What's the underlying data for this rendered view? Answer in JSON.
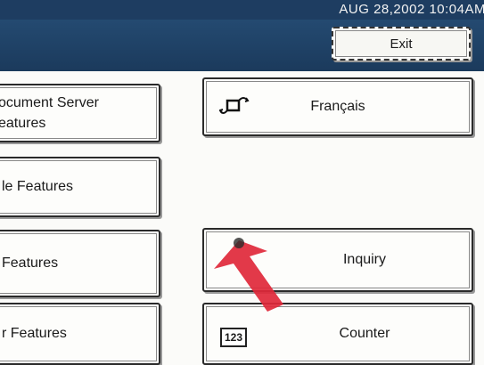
{
  "status": {
    "datetime": "AUG   28,2002 10:04AM"
  },
  "exit_label": "Exit",
  "left_buttons": {
    "document_server_line1": "ocument Server",
    "document_server_line2": "eatures",
    "file_features": "le Features",
    "features": "Features",
    "r_features": "r Features"
  },
  "right_buttons": {
    "language": "Français",
    "inquiry": "Inquiry",
    "counter": "Counter",
    "counter_icon": "123"
  },
  "colors": {
    "header": "#1e3d61",
    "pointer_arrow": "#e0283a"
  },
  "icons": [
    "language-switch-icon",
    "counter-123-icon",
    "pointer-arrow"
  ]
}
